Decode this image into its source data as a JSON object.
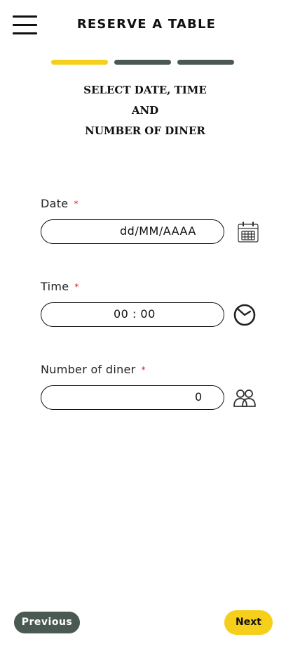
{
  "header": {
    "title": "RESERVE A TABLE",
    "menu_icon": "hamburger-menu-icon"
  },
  "progress": {
    "current_step": 1,
    "total_steps": 3,
    "active_color": "#f5cf1a",
    "inactive_color": "#4a5a52"
  },
  "step_heading": {
    "line1": "SELECT DATE, TIME",
    "line2": "AND",
    "line3": "NUMBER OF DINER"
  },
  "form": {
    "required_marker": "*",
    "required_color": "#d32020",
    "date": {
      "label": "Date",
      "value": "dd/MM/AAAA",
      "icon": "calendar-icon"
    },
    "time": {
      "label": "Time",
      "value": "00 : 00",
      "icon": "clock-icon"
    },
    "diners": {
      "label": "Number of diner",
      "value": "0",
      "icon": "people-icon"
    }
  },
  "footer": {
    "previous_label": "Previous",
    "next_label": "Next"
  }
}
